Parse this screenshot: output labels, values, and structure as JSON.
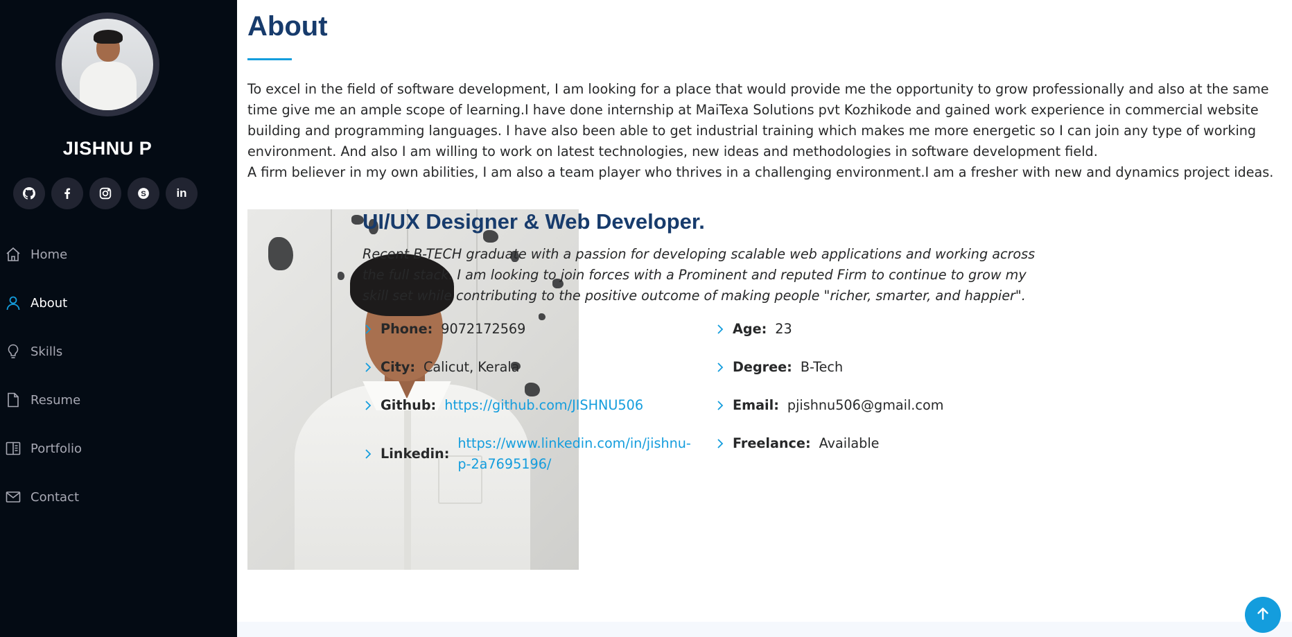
{
  "sidebar": {
    "name": "JISHNU P",
    "social": [
      {
        "icon": "github-icon",
        "label": "GitHub"
      },
      {
        "icon": "facebook-icon",
        "label": "Facebook"
      },
      {
        "icon": "instagram-icon",
        "label": "Instagram"
      },
      {
        "icon": "skype-icon",
        "label": "Skype"
      },
      {
        "icon": "linkedin-icon",
        "label": "LinkedIn",
        "glyph": "in"
      }
    ],
    "nav": [
      {
        "label": "Home",
        "icon": "home-icon",
        "active": false
      },
      {
        "label": "About",
        "icon": "person-icon",
        "active": true
      },
      {
        "label": "Skills",
        "icon": "lightbulb-icon",
        "active": false
      },
      {
        "label": "Resume",
        "icon": "file-icon",
        "active": false
      },
      {
        "label": "Portfolio",
        "icon": "book-icon",
        "active": false
      },
      {
        "label": "Contact",
        "icon": "envelope-icon",
        "active": false
      }
    ]
  },
  "about": {
    "title": "About",
    "intro_1": "To excel in the field of software development, I am looking for a place that would provide me the opportunity to grow professionally and also at the same time give me an ample scope of learning.I have done internship at MaiTexa Solutions pvt Kozhikode and gained work experience in commercial website building and programming languages. I have also been able to get industrial training which makes me more energetic so I can join any type of working environment. And also I am willing to work on latest technologies, new ideas and methodologies in software development field.",
    "intro_2": "A firm believer in my own abilities, I am also a team player who thrives in a challenging environment.I am a fresher with new and dynamics project ideas.",
    "role": "UI/UX Designer & Web Developer.",
    "summary": "Recent B-TECH graduate with a passion for developing scalable web applications and working across the full stack. I am looking to join forces with a Prominent and reputed Firm to continue to grow my skill set while contributing to the positive outcome of making people \"richer, smarter, and happier\".",
    "info": {
      "phone_label": "Phone:",
      "phone": "9072172569",
      "age_label": "Age:",
      "age": "23",
      "city_label": "City:",
      "city": "Calicut, Kerala",
      "degree_label": "Degree:",
      "degree": "B-Tech",
      "github_label": "Github:",
      "github": "https://github.com/JISHNU506",
      "email_label": "Email:",
      "email": "pjishnu506@gmail.com",
      "linkedin_label": "Linkedin:",
      "linkedin": "https://www.linkedin.com/in/jishnu-p-2a7695196/",
      "freelance_label": "Freelance:",
      "freelance": "Available"
    }
  },
  "colors": {
    "sidebar_bg": "#040b14",
    "accent": "#149ddd",
    "heading": "#173b6c"
  }
}
